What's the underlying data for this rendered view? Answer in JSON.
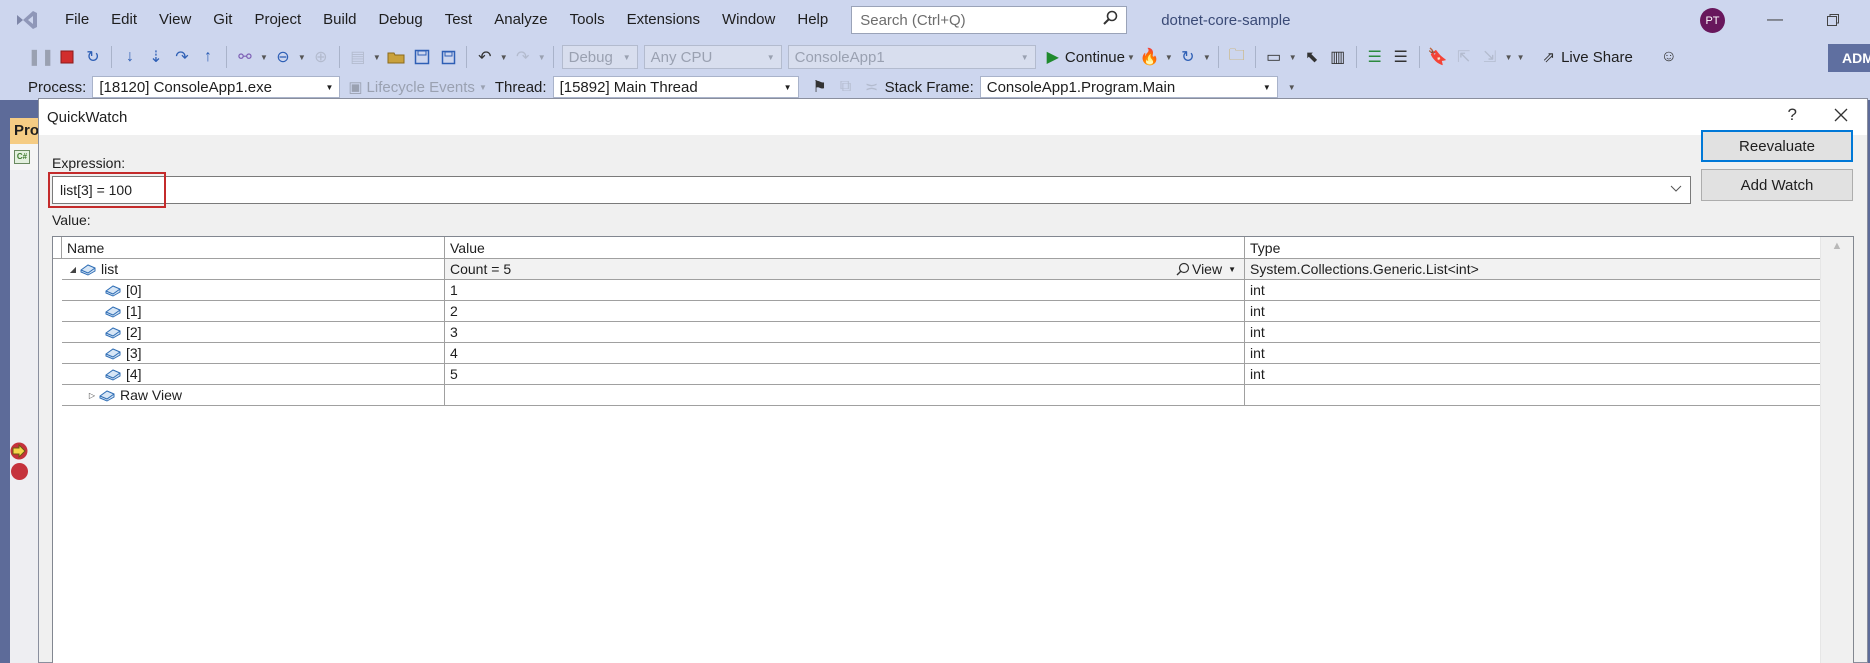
{
  "menubar": {
    "items": [
      "File",
      "Edit",
      "View",
      "Git",
      "Project",
      "Build",
      "Debug",
      "Test",
      "Analyze",
      "Tools",
      "Extensions",
      "Window",
      "Help"
    ],
    "search_placeholder": "Search (Ctrl+Q)",
    "solution_name": "dotnet-core-sample",
    "avatar_initials": "PT"
  },
  "toolbar": {
    "config": "Debug",
    "platform": "Any CPU",
    "startup_project": "ConsoleApp1",
    "continue_label": "Continue",
    "live_share_label": "Live Share",
    "admin_badge": "ADM"
  },
  "location_bar": {
    "process_label": "Process:",
    "process_value": "[18120] ConsoleApp1.exe",
    "lifecycle_label": "Lifecycle Events",
    "thread_label": "Thread:",
    "thread_value": "[15892] Main Thread",
    "stack_frame_label": "Stack Frame:",
    "stack_frame_value": "ConsoleApp1.Program.Main"
  },
  "side": {
    "tab_label": "Pro",
    "cs_badge": "C#"
  },
  "dialog": {
    "title": "QuickWatch",
    "help": "?",
    "close": "✕",
    "expression_label": "Expression:",
    "expression_value": "list[3] = 100",
    "value_label": "Value:",
    "reevaluate_label": "Reevaluate",
    "add_watch_label": "Add Watch",
    "grid": {
      "columns": [
        "Name",
        "Value",
        "Type"
      ],
      "view_label": "View",
      "rows": [
        {
          "name": "list",
          "value": "Count = 5",
          "type": "System.Collections.Generic.List<int>",
          "expanded": true
        },
        {
          "name": "[0]",
          "value": "1",
          "type": "int"
        },
        {
          "name": "[1]",
          "value": "2",
          "type": "int"
        },
        {
          "name": "[2]",
          "value": "3",
          "type": "int"
        },
        {
          "name": "[3]",
          "value": "4",
          "type": "int"
        },
        {
          "name": "[4]",
          "value": "5",
          "type": "int"
        },
        {
          "name": "Raw View",
          "value": "",
          "type": "",
          "expanded": false
        }
      ]
    }
  },
  "colors": {
    "chrome": "#cdd6ee",
    "highlight_box": "#c42b2b",
    "primary_button_border": "#0078d7",
    "avatar": "#68175c"
  }
}
